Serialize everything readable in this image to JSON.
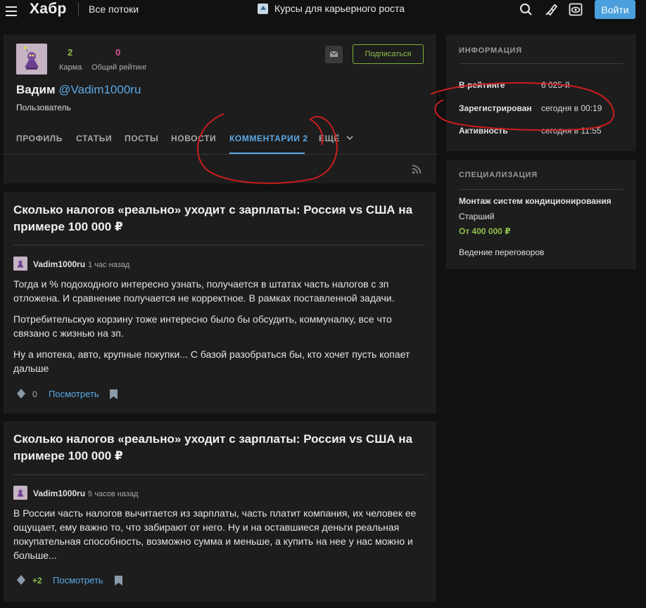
{
  "header": {
    "logo": "Хабр",
    "flows": "Все потоки",
    "promo": "Курсы для карьерного роста",
    "login": "Войти"
  },
  "profile": {
    "karma_value": "2",
    "karma_label": "Карма",
    "rating_value": "0",
    "rating_label": "Общий рейтинг",
    "subscribe": "Подписаться",
    "name": "Вадим",
    "nick": "@Vadim1000ru",
    "role": "Пользователь",
    "tabs": [
      "ПРОФИЛЬ",
      "СТАТЬИ",
      "ПОСТЫ",
      "НОВОСТИ",
      "КОММЕНТАРИИ 2",
      "ЕЩЁ"
    ],
    "active_tab": "КОММЕНТАРИИ 2"
  },
  "info": {
    "title": "ИНФОРМАЦИЯ",
    "rows": [
      {
        "label": "В рейтинге",
        "value": "6 025-й"
      },
      {
        "label": "Зарегистрирован",
        "value": "сегодня в 00:19"
      },
      {
        "label": "Активность",
        "value": "сегодня в 11:55"
      }
    ]
  },
  "spec": {
    "title": "СПЕЦИАЛИЗАЦИЯ",
    "position": "Монтаж систем кондиционирования",
    "level": "Старший",
    "salary": "От 400 000 ₽",
    "skill": "Ведение переговоров"
  },
  "comments": [
    {
      "title": "Сколько налогов «реально» уходит с зарплаты: Россия vs США на примере 100 000 ₽",
      "author": "Vadim1000ru",
      "time": "1 час назад",
      "paragraphs": [
        "Тогда и % подоходного интересно узнать, получается в штатах часть налогов с зп отложена. И сравнение получается не корректное. В рамках поставленной задачи.",
        "Потребительскую корзину тоже интересно было бы обсудить, коммуналку, все что связано с жизнью на зп.",
        "Ну а ипотека, авто, крупные покупки... С базой разобраться бы, кто хочет пусть копает дальше"
      ],
      "score": "0",
      "view": "Посмотреть"
    },
    {
      "title": "Сколько налогов «реально» уходит с зарплаты: Россия vs США на примере 100 000 ₽",
      "author": "Vadim1000ru",
      "time": "5 часов назад",
      "paragraphs": [
        "В России часть налогов вычитается из зарплаты, часть платит компания, их человек ее ощущает, ему важно то, что забирают от него. Ну и на оставшиеся деньги реальная покупательная способность, возможно сумма и меньше, а купить на нее у нас можно и больше..."
      ],
      "score": "+2",
      "view": "Посмотреть"
    }
  ],
  "colors": {
    "accent": "#5aa9e6",
    "positive": "#8fbf4a",
    "rating": "#e0569b",
    "annotation": "#cc1d1d"
  }
}
